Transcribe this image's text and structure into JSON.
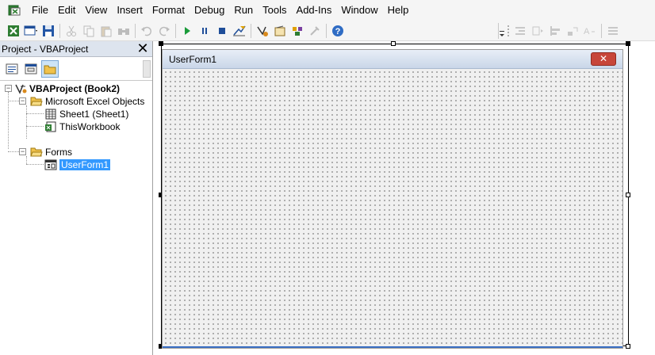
{
  "menu": {
    "items": [
      "File",
      "Edit",
      "View",
      "Insert",
      "Format",
      "Debug",
      "Run",
      "Tools",
      "Add-Ins",
      "Window",
      "Help"
    ]
  },
  "toolbar": {
    "icons": [
      "view-excel-icon",
      "insert-userform-icon",
      "save-icon",
      "cut-icon",
      "copy-icon",
      "paste-icon",
      "find-icon",
      "undo-icon",
      "redo-icon",
      "run-icon",
      "break-icon",
      "reset-icon",
      "design-mode-icon",
      "project-explorer-icon",
      "properties-icon",
      "object-browser-icon",
      "toolbox-icon",
      "help-icon"
    ]
  },
  "project": {
    "title": "Project - VBAProject",
    "close_label": "✕",
    "tree": {
      "root": "VBAProject (Book2)",
      "excel_objects": "Microsoft Excel Objects",
      "sheet1": "Sheet1 (Sheet1)",
      "thisworkbook": "ThisWorkbook",
      "forms": "Forms",
      "userform1": "UserForm1"
    }
  },
  "form": {
    "title": "UserForm1",
    "close_label": "✕"
  },
  "colors": {
    "selection": "#3399ff",
    "close_button": "#c7463a",
    "title_gradient": "#c9d6e8"
  }
}
